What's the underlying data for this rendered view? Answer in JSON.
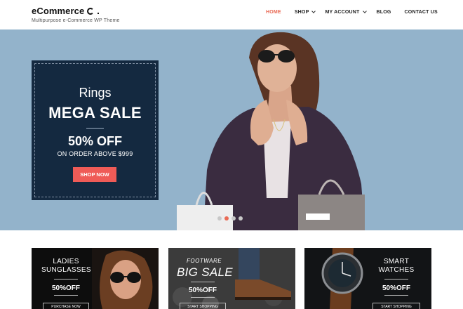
{
  "header": {
    "brand_name": "eCommerce",
    "brand_tagline": "Multipurpose e-Commerce WP Theme",
    "nav": [
      {
        "label": "HOME",
        "active": true,
        "has_dropdown": false
      },
      {
        "label": "SHOP",
        "active": false,
        "has_dropdown": true
      },
      {
        "label": "MY ACCOUNT",
        "active": false,
        "has_dropdown": true
      },
      {
        "label": "BLOG",
        "active": false,
        "has_dropdown": false
      },
      {
        "label": "CONTACT US",
        "active": false,
        "has_dropdown": false
      }
    ]
  },
  "hero": {
    "category": "Rings",
    "headline": "MEGA SALE",
    "discount": "50% OFF",
    "condition": "ON ORDER ABOVE $999",
    "button_label": "SHOP NOW",
    "slide_count": 4,
    "active_slide": 2
  },
  "cards": [
    {
      "title": "LADIES SUNGLASSES",
      "discount": "50%OFF",
      "button_label": "PURCHASE NOW"
    },
    {
      "subtitle": "FOOTWARE",
      "title": "BIG SALE",
      "discount": "50%OFF",
      "button_label": "START SHOPPING"
    },
    {
      "title": "SMART WATCHES",
      "discount": "50%OFF",
      "button_label": "START SHOPPING"
    }
  ],
  "colors": {
    "accent": "#e96a55",
    "button_red": "#ef5b57",
    "promo_bg": "#142940",
    "hero_bg": "#93b3cb",
    "card_bg": "#0d0d0d"
  }
}
